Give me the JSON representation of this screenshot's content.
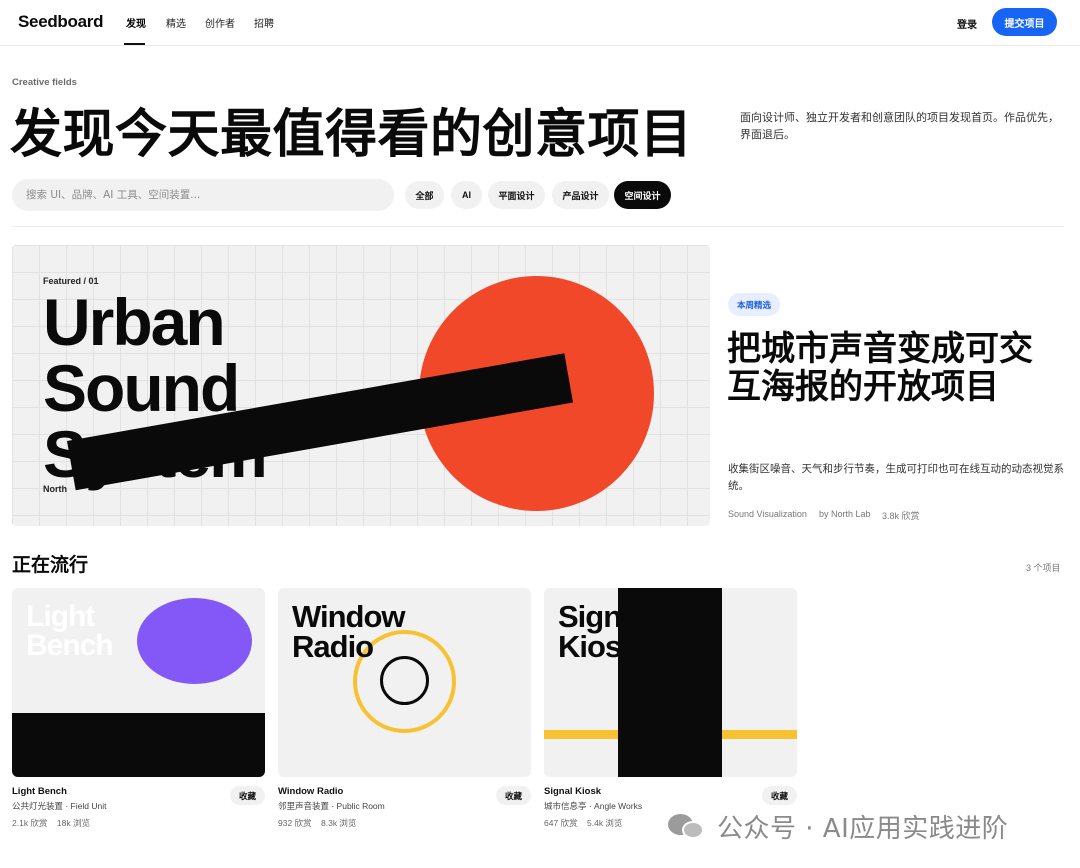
{
  "nav": {
    "logo": "Seedboard",
    "tabs": [
      {
        "label": "发现",
        "active": true
      },
      {
        "label": "精选",
        "active": false
      },
      {
        "label": "创作者",
        "active": false
      },
      {
        "label": "招聘",
        "active": false
      }
    ],
    "login": "登录",
    "submit": "提交项目"
  },
  "hero": {
    "eyebrow": "Creative fields",
    "title": "发现今天最值得看的创意项目",
    "description": "面向设计师、独立开发者和创意团队的项目发现首页。作品优先，界面退后。"
  },
  "search": {
    "placeholder": "搜索 UI、品牌、AI 工具、空间装置...",
    "value": ""
  },
  "filters": [
    {
      "label": "全部",
      "active": false
    },
    {
      "label": "AI",
      "active": false
    },
    {
      "label": "平面设计",
      "active": false
    },
    {
      "label": "产品设计",
      "active": false
    },
    {
      "label": "空间设计",
      "active": true
    }
  ],
  "featured": {
    "artwork": {
      "tag": "Featured / 01",
      "words": [
        "Urban",
        "Sound",
        "System"
      ],
      "small_label": "North",
      "circle_color": "#f2482a"
    },
    "badge": "本周精选",
    "title": "把城市声音变成可交互海报的开放项目",
    "description": "收集街区噪音、天气和步行节奏，生成可打印也可在线互动的动态视觉系统。",
    "category": "Sound Visualization",
    "author": "by North Lab",
    "views": "3.8k 欣赏"
  },
  "trending": {
    "title": "正在流行",
    "count": "3 个项目",
    "items": [
      {
        "title": "Light Bench",
        "subtitle": "公共灯光装置 · Field Unit",
        "likes": "2.1k 欣赏",
        "views": "18k 浏览",
        "fav": "收藏",
        "art_words": [
          "Light",
          "Bench"
        ],
        "accent": "#8458f7"
      },
      {
        "title": "Window Radio",
        "subtitle": "邻里声音装置 · Public Room",
        "likes": "932 欣赏",
        "views": "8.3k 浏览",
        "fav": "收藏",
        "art_words": [
          "Window",
          "Radio"
        ],
        "accent": "#f7c131"
      },
      {
        "title": "Signal Kiosk",
        "subtitle": "城市信息亭 · Angle Works",
        "likes": "647 欣赏",
        "views": "5.4k 浏览",
        "fav": "收藏",
        "art_words": [
          "Signal",
          "Kiosk"
        ],
        "accent": "#f7c131"
      }
    ]
  },
  "watermark": {
    "text": "公众号 · AI应用实践进阶",
    "icon": "wechat-icon"
  },
  "colors": {
    "primary": "#1665f5",
    "dark": "#0a0a0a",
    "orange": "#f2482a",
    "purple": "#8458f7",
    "yellow": "#f7c131"
  }
}
